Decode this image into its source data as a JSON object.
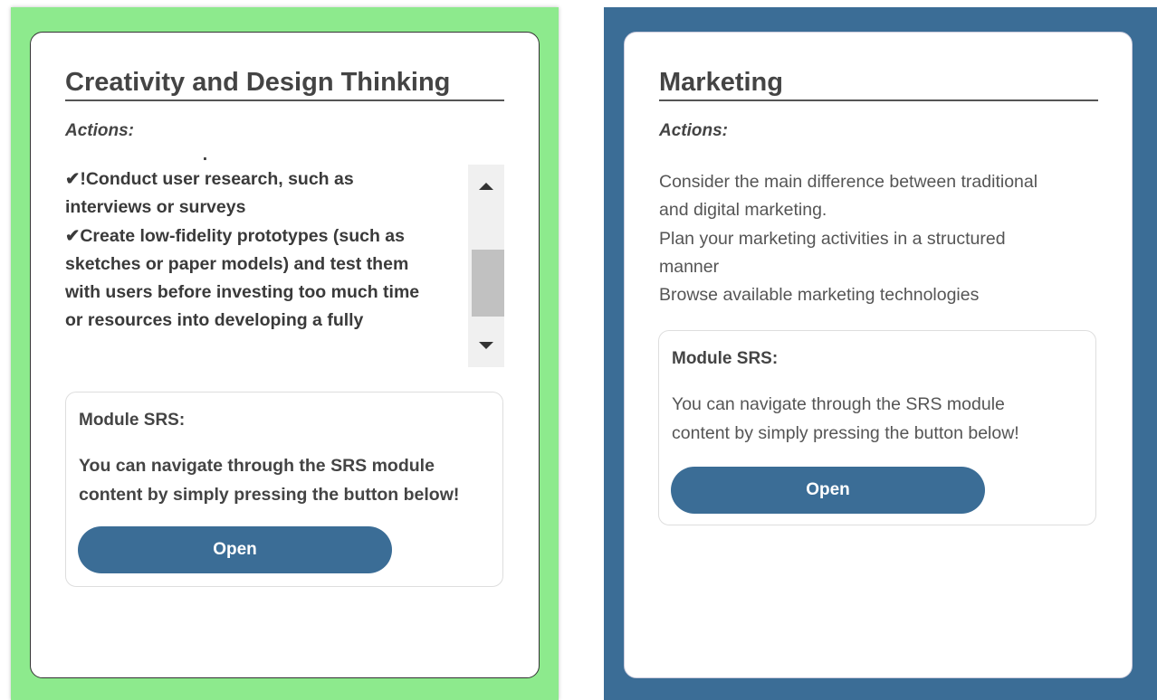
{
  "left_card": {
    "title": "Creativity and Design Thinking",
    "actions_label": "Actions:",
    "actions_lines": [
      "a new idea for a product or service",
      "✔!Conduct user research, such as",
      "interviews or surveys",
      "✔Create low-fidelity prototypes (such as",
      "sketches or paper models) and test them",
      "with users before investing too much time",
      "or resources into developing a fully"
    ],
    "module": {
      "title": "Module SRS:",
      "text_lines": [
        "You can navigate through the SRS module",
        "content by simply pressing the button below!"
      ],
      "button_label": "Open"
    }
  },
  "right_card": {
    "title": "Marketing",
    "actions_label": "Actions:",
    "actions_lines": [
      "Consider the main difference between traditional",
      "and digital marketing.",
      "Plan your marketing activities in a structured",
      "manner",
      "Browse available marketing technologies"
    ],
    "module": {
      "title": "Module SRS:",
      "text_lines": [
        "You can navigate through the SRS module",
        "content by simply pressing the button below!"
      ],
      "button_label": "Open"
    }
  },
  "colors": {
    "left_panel_bg": "#8dea8d",
    "right_panel_bg": "#3b6d96",
    "button_bg": "#3b6d96"
  }
}
